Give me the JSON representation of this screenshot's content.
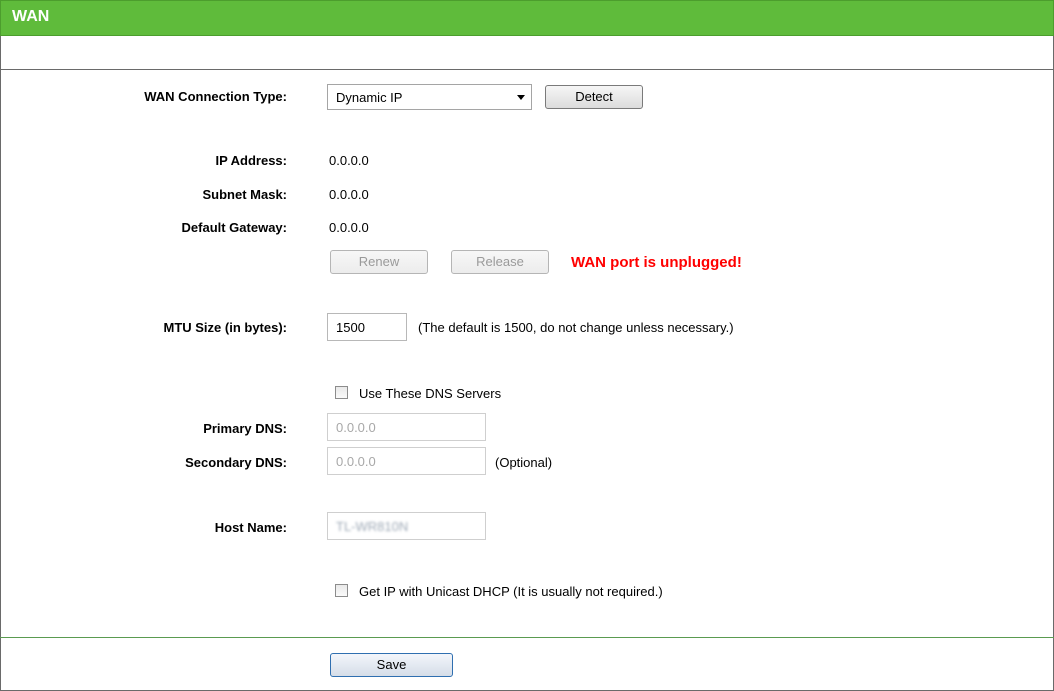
{
  "header": {
    "title": "WAN"
  },
  "wan_type": {
    "label": "WAN Connection Type:",
    "selected": "Dynamic IP",
    "detect_label": "Detect"
  },
  "ip_info": {
    "ip_label": "IP Address:",
    "ip_value": "0.0.0.0",
    "mask_label": "Subnet Mask:",
    "mask_value": "0.0.0.0",
    "gateway_label": "Default Gateway:",
    "gateway_value": "0.0.0.0",
    "renew_label": "Renew",
    "release_label": "Release",
    "status_message": "WAN port is unplugged!"
  },
  "mtu": {
    "label": "MTU Size (in bytes):",
    "value": "1500",
    "hint": "(The default is 1500, do not change unless necessary.)"
  },
  "dns": {
    "use_label": "Use These DNS Servers",
    "use_checked": false,
    "primary_label": "Primary DNS:",
    "primary_value": "0.0.0.0",
    "secondary_label": "Secondary DNS:",
    "secondary_value": "0.0.0.0",
    "optional_label": "(Optional)"
  },
  "host": {
    "label": "Host Name:",
    "value": "TL-WR810N"
  },
  "unicast": {
    "label": "Get IP with Unicast DHCP (It is usually not required.)",
    "checked": false
  },
  "actions": {
    "save_label": "Save"
  },
  "colors": {
    "header_green": "#5fbb3b",
    "status_red": "#ff0000"
  }
}
